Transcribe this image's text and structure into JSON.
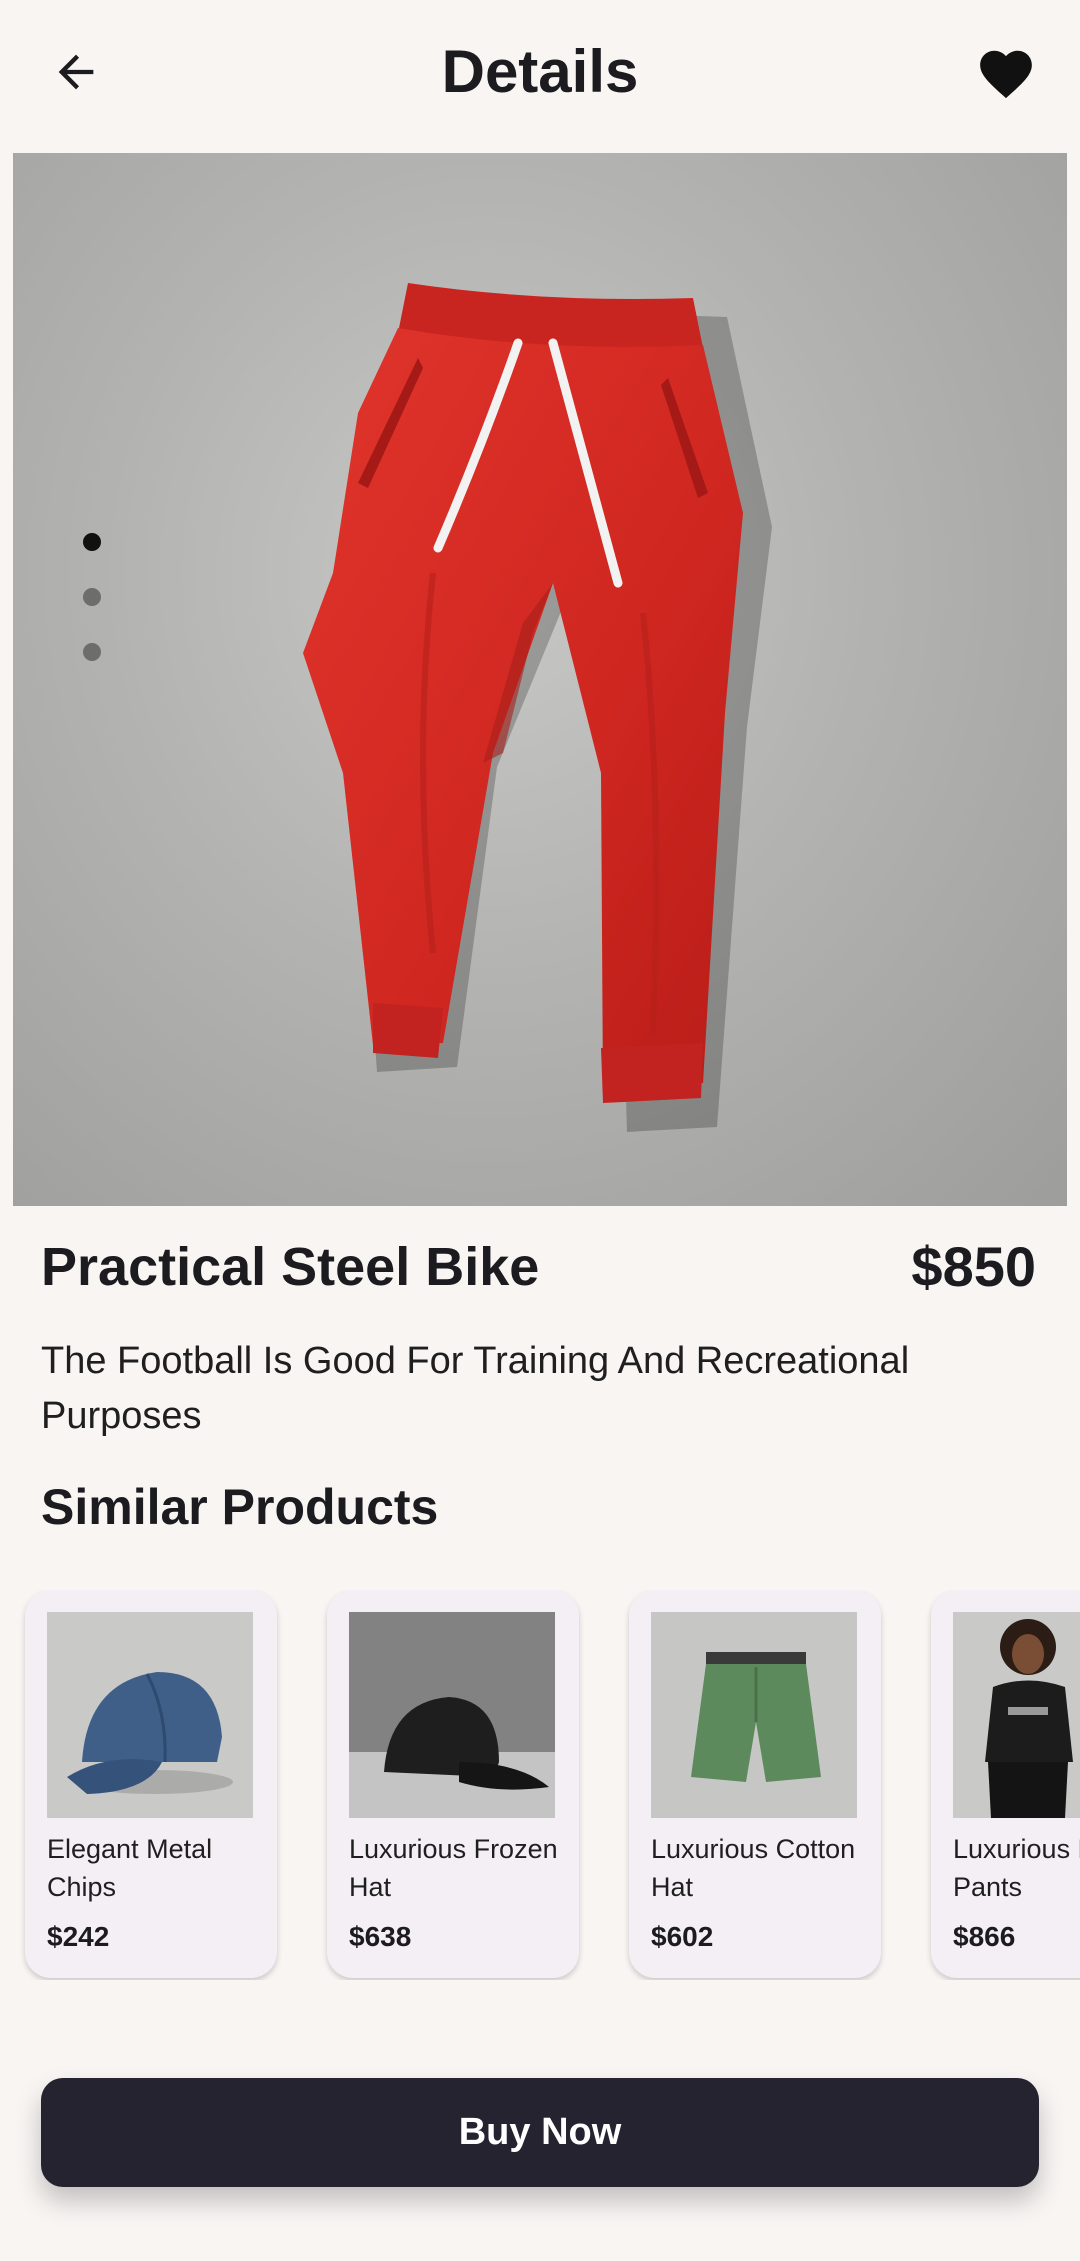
{
  "header": {
    "title": "Details",
    "back_icon": "arrow-back-icon",
    "favorite_icon": "heart-filled-icon"
  },
  "gallery": {
    "image": "red-sweatpants-photo",
    "active_index": 0,
    "dot_count": 3
  },
  "product": {
    "name": "Practical Steel Bike",
    "price": "$850",
    "description": "The Football Is Good For Training And Recreational Purposes"
  },
  "similar": {
    "title": "Similar Products",
    "items": [
      {
        "name": "Elegant Metal Chips",
        "price": "$242",
        "image": "blue-cap-photo"
      },
      {
        "name": "Luxurious Frozen Hat",
        "price": "$638",
        "image": "black-cap-photo"
      },
      {
        "name": "Luxurious Cotton Hat",
        "price": "$602",
        "image": "green-shorts-photo"
      },
      {
        "name": "Luxurious Rubber Pants",
        "price": "$866",
        "image": "black-tshirt-model-photo"
      }
    ]
  },
  "actions": {
    "buy_label": "Buy Now"
  },
  "colors": {
    "background": "#f8f5f3",
    "button": "#24232f",
    "card": "#f4eff5",
    "product_red": "#d42a24"
  }
}
